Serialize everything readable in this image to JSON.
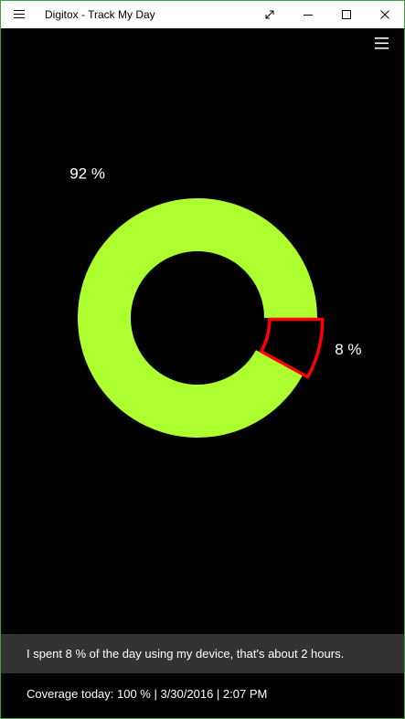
{
  "window": {
    "title": "Digitox - Track My Day",
    "icons": {
      "menu": "hamburger-icon",
      "expand": "expand-diagonal-icon",
      "minimize": "minimize-icon",
      "maximize": "maximize-icon",
      "close": "close-icon"
    }
  },
  "app_menu_icon": "hamburger-icon",
  "chart_data": {
    "type": "pie",
    "style": "donut",
    "slices": [
      {
        "label": "92 %",
        "value": 92,
        "color": "#adff2f",
        "highlighted": false
      },
      {
        "label": "8 %",
        "value": 8,
        "color": "#000000",
        "outline": "#ff0000",
        "highlighted": true
      }
    ],
    "title": "",
    "legend": "none"
  },
  "summary": {
    "text": "I spent 8 % of the day using my device, that's about 2 hours."
  },
  "coverage": {
    "text": "Coverage today: 100 % | 3/30/2016 | 2:07 PM"
  },
  "colors": {
    "background": "#000000",
    "titlebar": "#ffffff",
    "window_border": "#3f9e3f",
    "summary_bar": "#333333",
    "donut_fill": "#adff2f",
    "highlight_outline": "#ff0000"
  }
}
